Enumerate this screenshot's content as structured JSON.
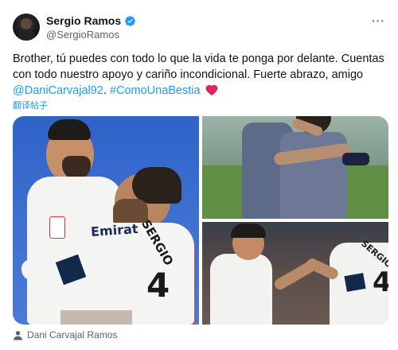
{
  "author": {
    "display_name": "Sergio Ramos",
    "handle": "@SergioRamos",
    "verified": true
  },
  "tweet": {
    "text_part1": "Brother, tú puedes con todo lo que la vida te ponga por delante. Cuentas con todo nuestro apoyo y cariño incondicional. Fuerte abrazo, amigo ",
    "mention": "@DaniCarvajal92",
    "separator": ". ",
    "hashtag": "#ComoUnaBestia",
    "translate_label": "翻译帖子"
  },
  "media": {
    "photo_count": 3,
    "photo1_jersey_text": "Emirat",
    "photo1_name_text": "SERGIO",
    "photo1_number": "4",
    "photo3_name_text": "SERGIO",
    "photo3_number": "4"
  },
  "tagged": {
    "people": "Dani Carvajal Ramos"
  },
  "colors": {
    "accent": "#1d9bf0",
    "text": "#0f1419",
    "secondary_text": "#536471",
    "heart": "#f91880"
  },
  "icons": [
    "verified-badge-icon",
    "more-options-icon",
    "heart-icon",
    "person-icon"
  ]
}
